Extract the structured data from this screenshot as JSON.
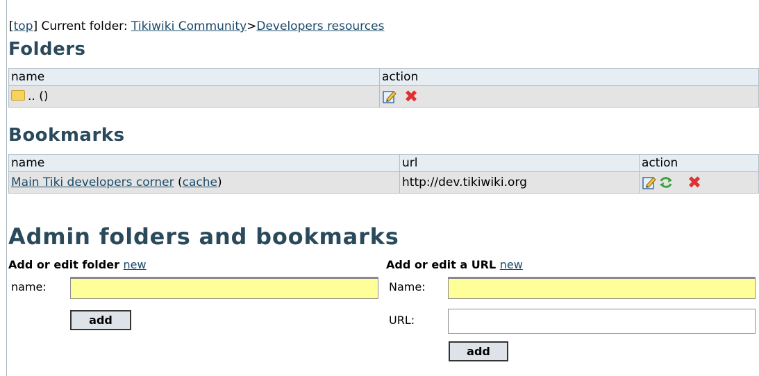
{
  "breadcrumb": {
    "open_bracket": "[",
    "top_link": "top",
    "close_bracket": "] Current folder: ",
    "folder1": "Tikiwiki Community",
    "separator": ">",
    "folder2": "Developers resources"
  },
  "folders": {
    "heading": "Folders",
    "col_name": "name",
    "col_action": "action",
    "rows": [
      {
        "name": ".. ()"
      }
    ]
  },
  "bookmarks": {
    "heading": "Bookmarks",
    "col_name": "name",
    "col_url": "url",
    "col_action": "action",
    "rows": [
      {
        "name": "Main Tiki developers corner",
        "cache_open": " (",
        "cache": "cache",
        "cache_close": ")",
        "url": "http://dev.tikiwiki.org"
      }
    ]
  },
  "admin": {
    "heading": "Admin folders and bookmarks",
    "folder_form": {
      "title": "Add or edit folder",
      "new_link": "new",
      "name_label": "name:",
      "name_value": "",
      "add_label": "add"
    },
    "url_form": {
      "title": "Add or edit a URL",
      "new_link": "new",
      "name_label": "Name:",
      "name_value": "",
      "url_label": "URL:",
      "url_value": "",
      "add_label": "add"
    }
  },
  "icons": {
    "folder": "folder-icon",
    "edit": "edit-icon",
    "delete": "delete-icon",
    "refresh": "refresh-icon"
  }
}
